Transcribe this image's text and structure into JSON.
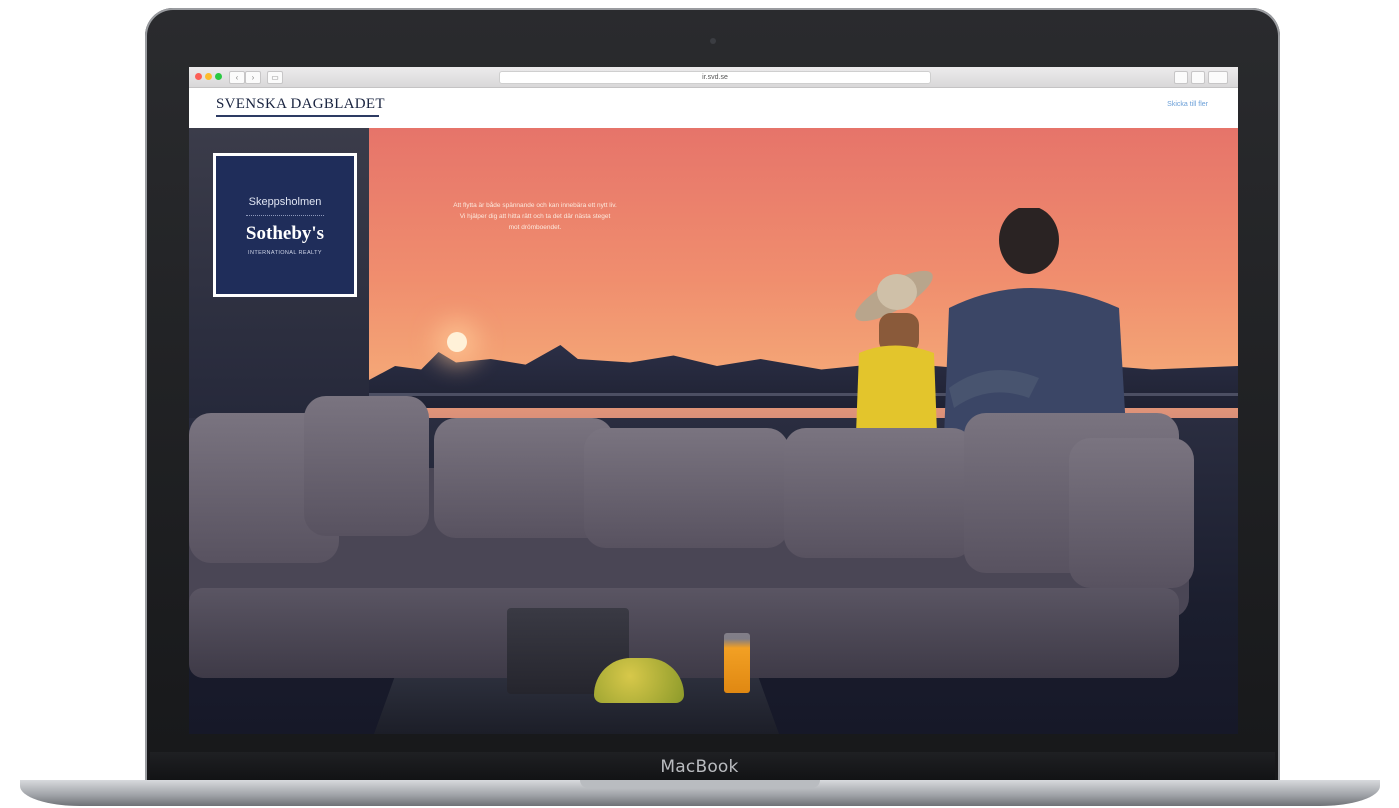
{
  "device": {
    "brand_label": "MacBook"
  },
  "browser": {
    "url": "ir.svd.se"
  },
  "site": {
    "masthead": "SVENSKA DAGBLADET",
    "header_link": "Skicka till fler"
  },
  "hero": {
    "badge": {
      "line1": "Skeppsholmen",
      "line2": "Sotheby's",
      "line3": "INTERNATIONAL REALTY"
    },
    "copy_line1": "Att flytta är både spännande och kan innebära ett nytt liv.",
    "copy_line2": "Vi hjälper dig att hitta rätt och ta det där nästa steget",
    "copy_line3": "mot drömboendet."
  },
  "colors": {
    "badge_navy": "#1f2d5a",
    "masthead_text": "#1a2440",
    "link_blue": "#6a9fd8"
  }
}
